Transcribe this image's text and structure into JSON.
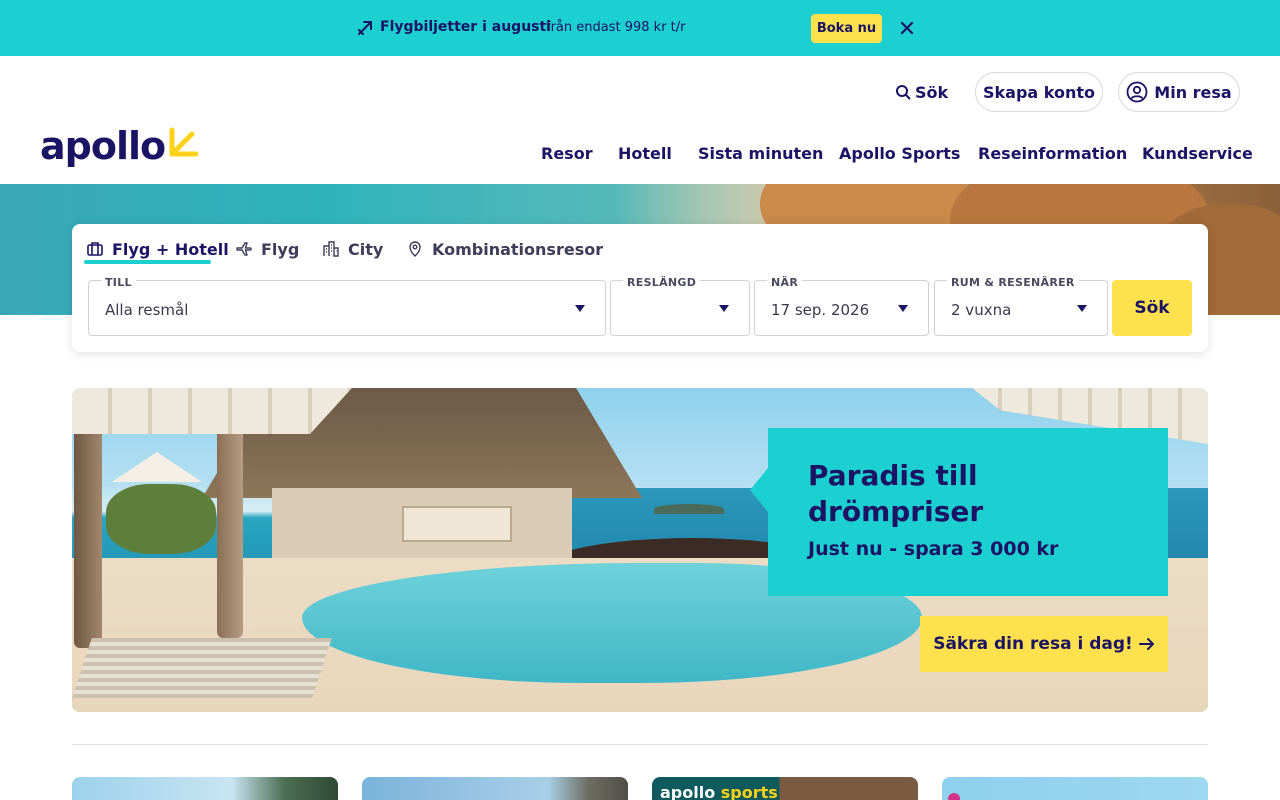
{
  "promo_banner": {
    "title": "Flygbiljetter i augusti",
    "subtitle": "från endast 998 kr t/r",
    "button": "Boka nu",
    "icons": [
      "plane-tag-icon",
      "close-icon"
    ]
  },
  "header": {
    "logo_text": "apollo",
    "search_label": "Sök",
    "create_account": "Skapa konto",
    "my_trip": "Min resa",
    "nav": [
      "Resor",
      "Hotell",
      "Sista minuten",
      "Apollo Sports",
      "Reseinformation",
      "Kundservice"
    ]
  },
  "search_panel": {
    "tabs": [
      {
        "label": "Flyg + Hotell",
        "icon": "suitcase-icon",
        "active": true
      },
      {
        "label": "Flyg",
        "icon": "plane-icon",
        "active": false
      },
      {
        "label": "City",
        "icon": "city-icon",
        "active": false
      },
      {
        "label": "Kombinationsresor",
        "icon": "map-pin-icon",
        "active": false
      }
    ],
    "fields": {
      "destination": {
        "label": "TILL",
        "value": "Alla resmål"
      },
      "length": {
        "label": "RESLÄNGD",
        "value": ""
      },
      "date": {
        "label": "NÄR",
        "value": "17 sep. 2026"
      },
      "rooms": {
        "label": "RUM & RESENÄRER",
        "value": "2 vuxna"
      }
    },
    "submit": "Sök"
  },
  "hero": {
    "title": "Paradis till drömpriser",
    "subtitle": "Just nu - spara 3 000 kr",
    "cta": "Säkra din resa i dag!"
  },
  "cards": {
    "sports_label_left": "apollo",
    "sports_label_right": "sports"
  },
  "colors": {
    "brand_navy": "#1b1464",
    "brand_turquoise": "#1ccfd0",
    "brand_yellow": "#ffe14d"
  }
}
